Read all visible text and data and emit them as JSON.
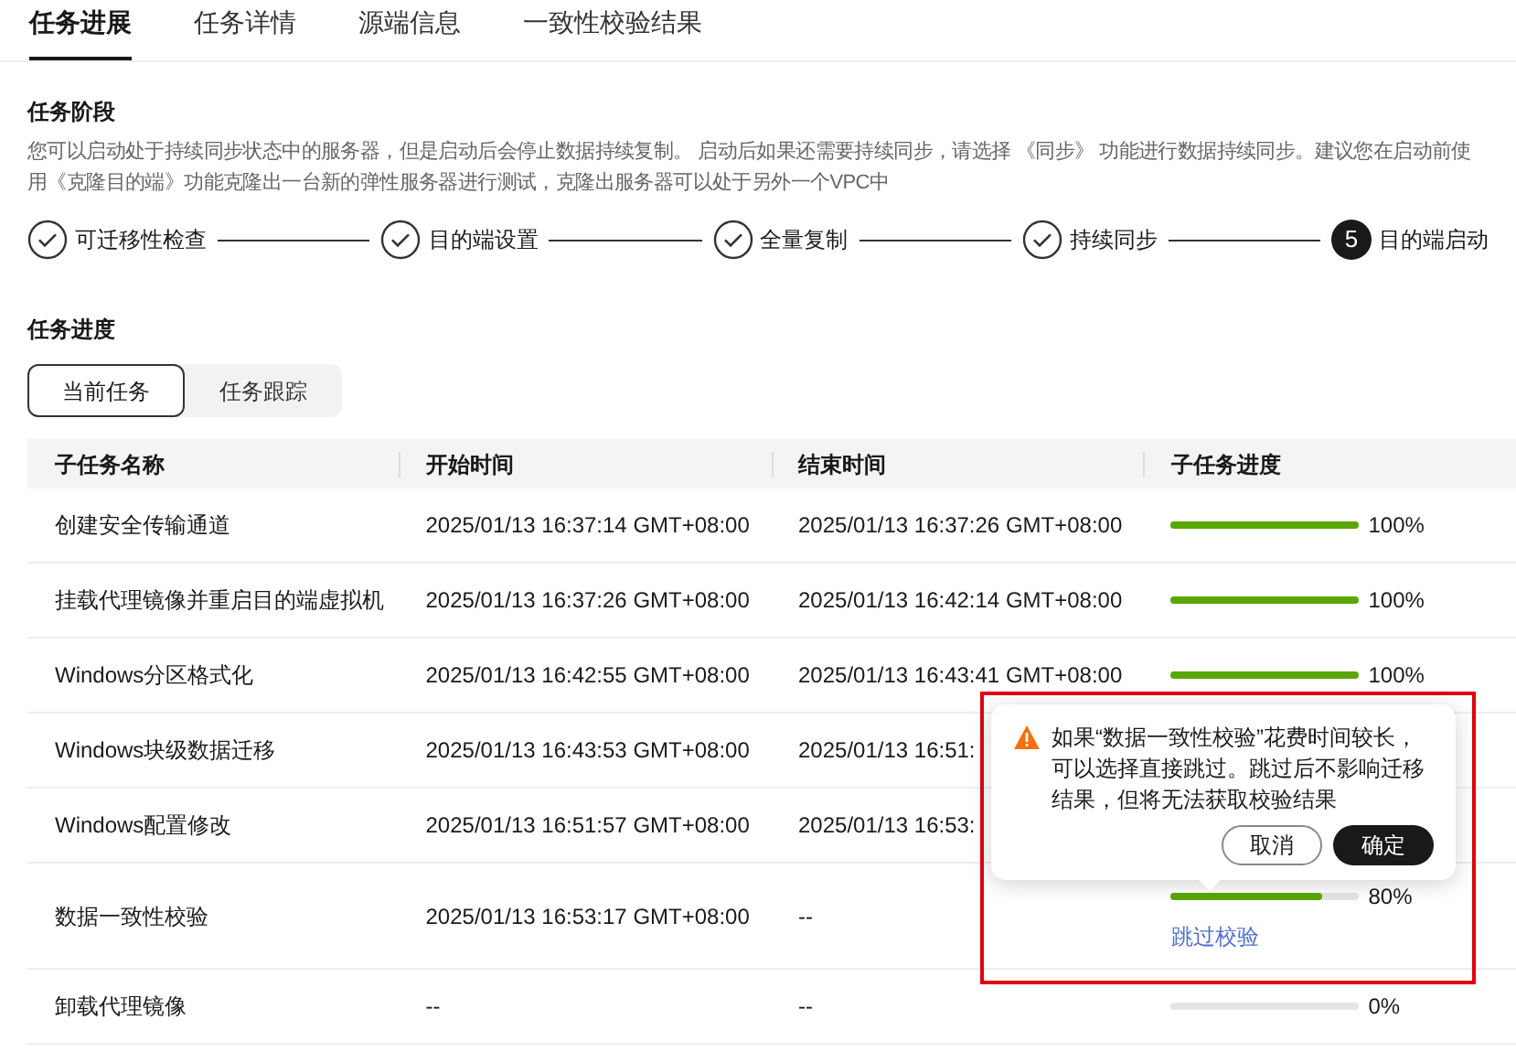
{
  "tabs": [
    {
      "label": "任务进展",
      "selected": true
    },
    {
      "label": "任务详情",
      "selected": false
    },
    {
      "label": "源端信息",
      "selected": false
    },
    {
      "label": "一致性校验结果",
      "selected": false
    }
  ],
  "stage": {
    "title": "任务阶段",
    "description": "您可以启动处于持续同步状态中的服务器，但是启动后会停止数据持续复制。 启动后如果还需要持续同步，请选择 《同步》 功能进行数据持续同步。建议您在启动前使用《克隆目的端》功能克隆出一台新的弹性服务器进行测试，克隆出服务器可以处于另外一个VPC中",
    "steps": [
      {
        "label": "可迁移性检查",
        "done": true
      },
      {
        "label": "目的端设置",
        "done": true
      },
      {
        "label": "全量复制",
        "done": true
      },
      {
        "label": "持续同步",
        "done": true
      },
      {
        "label": "目的端启动",
        "done": false,
        "number": "5"
      }
    ]
  },
  "progress": {
    "title": "任务进度",
    "segments": [
      {
        "label": "当前任务",
        "selected": true
      },
      {
        "label": "任务跟踪",
        "selected": false
      }
    ],
    "columns": [
      "子任务名称",
      "开始时间",
      "结束时间",
      "子任务进度"
    ],
    "rows": [
      {
        "name": "创建安全传输通道",
        "start": "2025/01/13 16:37:14 GMT+08:00",
        "end": "2025/01/13 16:37:26 GMT+08:00",
        "level": 1,
        "percent": "100%"
      },
      {
        "name": "挂载代理镜像并重启目的端虚拟机",
        "start": "2025/01/13 16:37:26 GMT+08:00",
        "end": "2025/01/13 16:42:14 GMT+08:00",
        "level": 1,
        "percent": "100%"
      },
      {
        "name": "Windows分区格式化",
        "start": "2025/01/13 16:42:55 GMT+08:00",
        "end": "2025/01/13 16:43:41 GMT+08:00",
        "level": 1,
        "percent": "100%"
      },
      {
        "name": "Windows块级数据迁移",
        "start": "2025/01/13 16:43:53 GMT+08:00",
        "end": "2025/01/13 16:51:"
      },
      {
        "name": "Windows配置修改",
        "start": "2025/01/13 16:51:57 GMT+08:00",
        "end": "2025/01/13 16:53:"
      },
      {
        "name": "数据一致性校验",
        "start": "2025/01/13 16:53:17 GMT+08:00",
        "end": "--",
        "level": 0.8,
        "percent": "80%",
        "link": "跳过校验"
      },
      {
        "name": "卸载代理镜像",
        "start": "--",
        "end": "--",
        "level": 0,
        "percent": "0%"
      }
    ]
  },
  "popover": {
    "message": "如果“数据一致性校验”花费时间较长，可以选择直接跳过。跳过后不影响迁移结果，但将无法获取校验结果",
    "cancel": "取消",
    "confirm": "确定"
  }
}
